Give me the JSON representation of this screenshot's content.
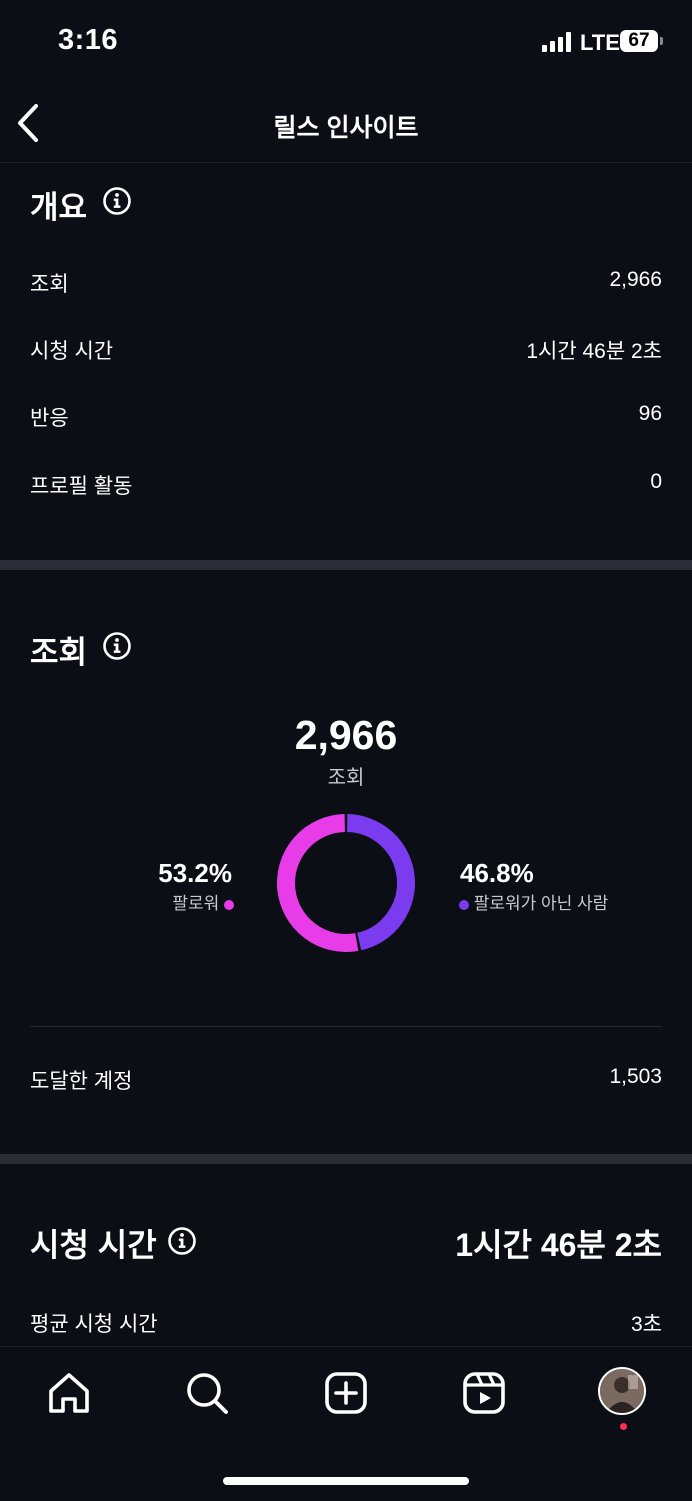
{
  "status_bar": {
    "time": "3:16",
    "network": "LTE",
    "battery": "67"
  },
  "header": {
    "title": "릴스 인사이트"
  },
  "overview": {
    "title": "개요",
    "rows": [
      {
        "label": "조회",
        "value": "2,966"
      },
      {
        "label": "시청 시간",
        "value": "1시간 46분 2초"
      },
      {
        "label": "반응",
        "value": "96"
      },
      {
        "label": "프로필 활동",
        "value": "0"
      }
    ]
  },
  "views": {
    "title": "조회",
    "total": "2,966",
    "total_label": "조회",
    "followers_pct": "53.2%",
    "followers_label": "팔로워",
    "nonfollowers_pct": "46.8%",
    "nonfollowers_label": "팔로워가 아닌 사람",
    "accounts_reached_label": "도달한 계정",
    "accounts_reached_value": "1,503",
    "colors": {
      "followers": "#e83ce8",
      "nonfollowers": "#7b3cf0"
    }
  },
  "watch_time": {
    "title": "시청 시간",
    "total": "1시간 46분 2초",
    "avg_label": "평균 시청 시간",
    "avg_value": "3초"
  },
  "chart_data": {
    "type": "pie",
    "categories": [
      "팔로워",
      "팔로워가 아닌 사람"
    ],
    "values": [
      53.2,
      46.8
    ],
    "title": "",
    "colors": [
      "#e83ce8",
      "#7b3cf0"
    ]
  },
  "tabbar": {
    "items": [
      "home-icon",
      "search-icon",
      "create-icon",
      "reels-icon",
      "profile-avatar"
    ]
  }
}
